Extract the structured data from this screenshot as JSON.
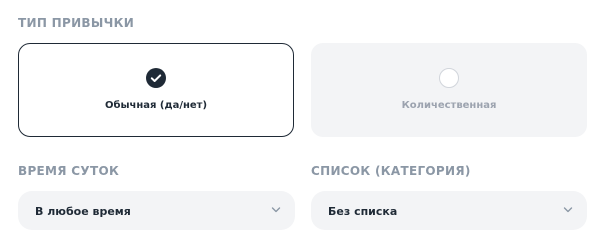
{
  "habit_type": {
    "label": "ТИП ПРИВЫЧКИ",
    "options": [
      {
        "label": "Обычная (да/нет)",
        "selected": true
      },
      {
        "label": "Количественная",
        "selected": false
      }
    ]
  },
  "time_of_day": {
    "label": "ВРЕМЯ СУТОК",
    "value": "В любое время",
    "icon": "chevron-down-icon"
  },
  "list": {
    "label": "СПИСОК (КАТЕГОРИЯ)",
    "value": "Без списка",
    "icon": "chevron-down-icon"
  },
  "colors": {
    "accent": "#1f2a36",
    "muted_label": "#8b97a5",
    "card_bg": "#f3f4f6"
  }
}
